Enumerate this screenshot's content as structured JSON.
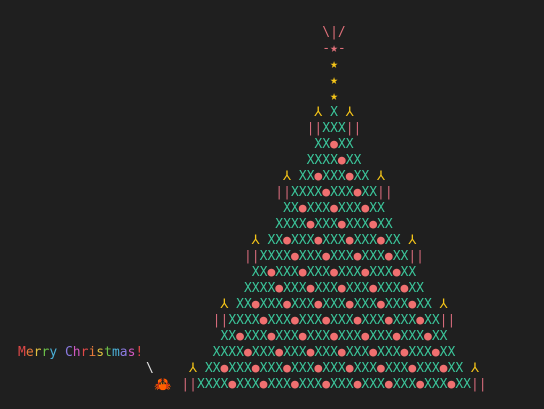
{
  "colors": {
    "background": "#1f1f1f",
    "star": "#f5c518",
    "tree": "#3bc59a",
    "ornament": "#f07070",
    "trunk": "#d46a7a",
    "arm": "#f5c518",
    "star_top": "#e0707a",
    "crab": "#e06030"
  },
  "tree_lines": [
    [
      {
        "t": "\\|/",
        "c": "star_top"
      }
    ],
    [
      {
        "t": "-★-",
        "c": "star_top"
      }
    ],
    [
      {
        "t": "★",
        "c": "star"
      }
    ],
    [
      {
        "t": "★",
        "c": "star"
      }
    ],
    [
      {
        "t": "★",
        "c": "star"
      }
    ],
    [
      {
        "t": "⅄ ",
        "c": "arm"
      },
      {
        "t": "X",
        "c": "tree"
      },
      {
        "t": " ⅄",
        "c": "arm"
      }
    ],
    [
      {
        "t": "||",
        "c": "trunk"
      },
      {
        "t": "XXX",
        "c": "tree"
      },
      {
        "t": "||",
        "c": "trunk"
      }
    ],
    [
      {
        "t": "XX",
        "c": "tree"
      },
      {
        "t": "●",
        "c": "ornament"
      },
      {
        "t": "XX",
        "c": "tree"
      }
    ],
    [
      {
        "t": "XXXX",
        "c": "tree"
      },
      {
        "t": "●",
        "c": "ornament"
      },
      {
        "t": "XX",
        "c": "tree"
      }
    ],
    [
      {
        "t": "⅄ ",
        "c": "arm"
      },
      {
        "t": "XX",
        "c": "tree"
      },
      {
        "t": "●",
        "c": "ornament"
      },
      {
        "t": "XXX",
        "c": "tree"
      },
      {
        "t": "●",
        "c": "ornament"
      },
      {
        "t": "XX",
        "c": "tree"
      },
      {
        "t": " ⅄",
        "c": "arm"
      }
    ],
    [
      {
        "t": "||",
        "c": "trunk"
      },
      {
        "t": "XXXX",
        "c": "tree"
      },
      {
        "t": "●",
        "c": "ornament"
      },
      {
        "t": "XXX",
        "c": "tree"
      },
      {
        "t": "●",
        "c": "ornament"
      },
      {
        "t": "XX",
        "c": "tree"
      },
      {
        "t": "||",
        "c": "trunk"
      }
    ],
    [
      {
        "t": "XX",
        "c": "tree"
      },
      {
        "t": "●",
        "c": "ornament"
      },
      {
        "t": "XXX",
        "c": "tree"
      },
      {
        "t": "●",
        "c": "ornament"
      },
      {
        "t": "XXX",
        "c": "tree"
      },
      {
        "t": "●",
        "c": "ornament"
      },
      {
        "t": "XX",
        "c": "tree"
      }
    ],
    [
      {
        "t": "XXXX",
        "c": "tree"
      },
      {
        "t": "●",
        "c": "ornament"
      },
      {
        "t": "XXX",
        "c": "tree"
      },
      {
        "t": "●",
        "c": "ornament"
      },
      {
        "t": "XXX",
        "c": "tree"
      },
      {
        "t": "●",
        "c": "ornament"
      },
      {
        "t": "XX",
        "c": "tree"
      }
    ],
    [
      {
        "t": "⅄ ",
        "c": "arm"
      },
      {
        "t": "XX",
        "c": "tree"
      },
      {
        "t": "●",
        "c": "ornament"
      },
      {
        "t": "XXX",
        "c": "tree"
      },
      {
        "t": "●",
        "c": "ornament"
      },
      {
        "t": "XXX",
        "c": "tree"
      },
      {
        "t": "●",
        "c": "ornament"
      },
      {
        "t": "XXX",
        "c": "tree"
      },
      {
        "t": "●",
        "c": "ornament"
      },
      {
        "t": "XX",
        "c": "tree"
      },
      {
        "t": " ⅄",
        "c": "arm"
      }
    ],
    [
      {
        "t": "||",
        "c": "trunk"
      },
      {
        "t": "XXXX",
        "c": "tree"
      },
      {
        "t": "●",
        "c": "ornament"
      },
      {
        "t": "XXX",
        "c": "tree"
      },
      {
        "t": "●",
        "c": "ornament"
      },
      {
        "t": "XXX",
        "c": "tree"
      },
      {
        "t": "●",
        "c": "ornament"
      },
      {
        "t": "XXX",
        "c": "tree"
      },
      {
        "t": "●",
        "c": "ornament"
      },
      {
        "t": "XX",
        "c": "tree"
      },
      {
        "t": "||",
        "c": "trunk"
      }
    ],
    [
      {
        "t": "XX",
        "c": "tree"
      },
      {
        "t": "●",
        "c": "ornament"
      },
      {
        "t": "XXX",
        "c": "tree"
      },
      {
        "t": "●",
        "c": "ornament"
      },
      {
        "t": "XXX",
        "c": "tree"
      },
      {
        "t": "●",
        "c": "ornament"
      },
      {
        "t": "XXX",
        "c": "tree"
      },
      {
        "t": "●",
        "c": "ornament"
      },
      {
        "t": "XXX",
        "c": "tree"
      },
      {
        "t": "●",
        "c": "ornament"
      },
      {
        "t": "XX",
        "c": "tree"
      }
    ],
    [
      {
        "t": "XXXX",
        "c": "tree"
      },
      {
        "t": "●",
        "c": "ornament"
      },
      {
        "t": "XXX",
        "c": "tree"
      },
      {
        "t": "●",
        "c": "ornament"
      },
      {
        "t": "XXX",
        "c": "tree"
      },
      {
        "t": "●",
        "c": "ornament"
      },
      {
        "t": "XXX",
        "c": "tree"
      },
      {
        "t": "●",
        "c": "ornament"
      },
      {
        "t": "XXX",
        "c": "tree"
      },
      {
        "t": "●",
        "c": "ornament"
      },
      {
        "t": "XX",
        "c": "tree"
      }
    ],
    [
      {
        "t": "⅄ ",
        "c": "arm"
      },
      {
        "t": "XX",
        "c": "tree"
      },
      {
        "t": "●",
        "c": "ornament"
      },
      {
        "t": "XXX",
        "c": "tree"
      },
      {
        "t": "●",
        "c": "ornament"
      },
      {
        "t": "XXX",
        "c": "tree"
      },
      {
        "t": "●",
        "c": "ornament"
      },
      {
        "t": "XXX",
        "c": "tree"
      },
      {
        "t": "●",
        "c": "ornament"
      },
      {
        "t": "XXX",
        "c": "tree"
      },
      {
        "t": "●",
        "c": "ornament"
      },
      {
        "t": "XXX",
        "c": "tree"
      },
      {
        "t": "●",
        "c": "ornament"
      },
      {
        "t": "XX",
        "c": "tree"
      },
      {
        "t": " ⅄",
        "c": "arm"
      }
    ],
    [
      {
        "t": "||",
        "c": "trunk"
      },
      {
        "t": "XXXX",
        "c": "tree"
      },
      {
        "t": "●",
        "c": "ornament"
      },
      {
        "t": "XXX",
        "c": "tree"
      },
      {
        "t": "●",
        "c": "ornament"
      },
      {
        "t": "XXX",
        "c": "tree"
      },
      {
        "t": "●",
        "c": "ornament"
      },
      {
        "t": "XXX",
        "c": "tree"
      },
      {
        "t": "●",
        "c": "ornament"
      },
      {
        "t": "XXX",
        "c": "tree"
      },
      {
        "t": "●",
        "c": "ornament"
      },
      {
        "t": "XXX",
        "c": "tree"
      },
      {
        "t": "●",
        "c": "ornament"
      },
      {
        "t": "XX",
        "c": "tree"
      },
      {
        "t": "||",
        "c": "trunk"
      }
    ],
    [
      {
        "t": "XX",
        "c": "tree"
      },
      {
        "t": "●",
        "c": "ornament"
      },
      {
        "t": "XXX",
        "c": "tree"
      },
      {
        "t": "●",
        "c": "ornament"
      },
      {
        "t": "XXX",
        "c": "tree"
      },
      {
        "t": "●",
        "c": "ornament"
      },
      {
        "t": "XXX",
        "c": "tree"
      },
      {
        "t": "●",
        "c": "ornament"
      },
      {
        "t": "XXX",
        "c": "tree"
      },
      {
        "t": "●",
        "c": "ornament"
      },
      {
        "t": "XXX",
        "c": "tree"
      },
      {
        "t": "●",
        "c": "ornament"
      },
      {
        "t": "XXX",
        "c": "tree"
      },
      {
        "t": "●",
        "c": "ornament"
      },
      {
        "t": "XX",
        "c": "tree"
      }
    ],
    [
      {
        "t": "XXXX",
        "c": "tree"
      },
      {
        "t": "●",
        "c": "ornament"
      },
      {
        "t": "XXX",
        "c": "tree"
      },
      {
        "t": "●",
        "c": "ornament"
      },
      {
        "t": "XXX",
        "c": "tree"
      },
      {
        "t": "●",
        "c": "ornament"
      },
      {
        "t": "XXX",
        "c": "tree"
      },
      {
        "t": "●",
        "c": "ornament"
      },
      {
        "t": "XXX",
        "c": "tree"
      },
      {
        "t": "●",
        "c": "ornament"
      },
      {
        "t": "XXX",
        "c": "tree"
      },
      {
        "t": "●",
        "c": "ornament"
      },
      {
        "t": "XXX",
        "c": "tree"
      },
      {
        "t": "●",
        "c": "ornament"
      },
      {
        "t": "XX",
        "c": "tree"
      }
    ],
    [
      {
        "t": "⅄ ",
        "c": "arm"
      },
      {
        "t": "XX",
        "c": "tree"
      },
      {
        "t": "●",
        "c": "ornament"
      },
      {
        "t": "XXX",
        "c": "tree"
      },
      {
        "t": "●",
        "c": "ornament"
      },
      {
        "t": "XXX",
        "c": "tree"
      },
      {
        "t": "●",
        "c": "ornament"
      },
      {
        "t": "XXX",
        "c": "tree"
      },
      {
        "t": "●",
        "c": "ornament"
      },
      {
        "t": "XXX",
        "c": "tree"
      },
      {
        "t": "●",
        "c": "ornament"
      },
      {
        "t": "XXX",
        "c": "tree"
      },
      {
        "t": "●",
        "c": "ornament"
      },
      {
        "t": "XXX",
        "c": "tree"
      },
      {
        "t": "●",
        "c": "ornament"
      },
      {
        "t": "XXX",
        "c": "tree"
      },
      {
        "t": "●",
        "c": "ornament"
      },
      {
        "t": "XX",
        "c": "tree"
      },
      {
        "t": " ⅄",
        "c": "arm"
      }
    ],
    [
      {
        "t": "||",
        "c": "trunk"
      },
      {
        "t": "XXXX",
        "c": "tree"
      },
      {
        "t": "●",
        "c": "ornament"
      },
      {
        "t": "XXX",
        "c": "tree"
      },
      {
        "t": "●",
        "c": "ornament"
      },
      {
        "t": "XXX",
        "c": "tree"
      },
      {
        "t": "●",
        "c": "ornament"
      },
      {
        "t": "XXX",
        "c": "tree"
      },
      {
        "t": "●",
        "c": "ornament"
      },
      {
        "t": "XXX",
        "c": "tree"
      },
      {
        "t": "●",
        "c": "ornament"
      },
      {
        "t": "XXX",
        "c": "tree"
      },
      {
        "t": "●",
        "c": "ornament"
      },
      {
        "t": "XXX",
        "c": "tree"
      },
      {
        "t": "●",
        "c": "ornament"
      },
      {
        "t": "XXX",
        "c": "tree"
      },
      {
        "t": "●",
        "c": "ornament"
      },
      {
        "t": "XX",
        "c": "tree"
      },
      {
        "t": "||",
        "c": "trunk"
      }
    ]
  ],
  "greeting": [
    {
      "t": "M",
      "color": "#e04848"
    },
    {
      "t": "e",
      "color": "#e87a3a"
    },
    {
      "t": "r",
      "color": "#e0c040"
    },
    {
      "t": "r",
      "color": "#6cc04a"
    },
    {
      "t": "y",
      "color": "#4ab0d8"
    },
    {
      "t": " ",
      "color": "#cccccc"
    },
    {
      "t": "C",
      "color": "#8a7ae0"
    },
    {
      "t": "h",
      "color": "#d058c0"
    },
    {
      "t": "r",
      "color": "#e04848"
    },
    {
      "t": "i",
      "color": "#e87a3a"
    },
    {
      "t": "s",
      "color": "#e0c040"
    },
    {
      "t": "t",
      "color": "#6cc04a"
    },
    {
      "t": "m",
      "color": "#4ab0d8"
    },
    {
      "t": "a",
      "color": "#8a7ae0"
    },
    {
      "t": "s",
      "color": "#d058c0"
    },
    {
      "t": "!",
      "color": "#e04848"
    }
  ],
  "crab": {
    "slash": "\\",
    "glyph": "🦀"
  }
}
